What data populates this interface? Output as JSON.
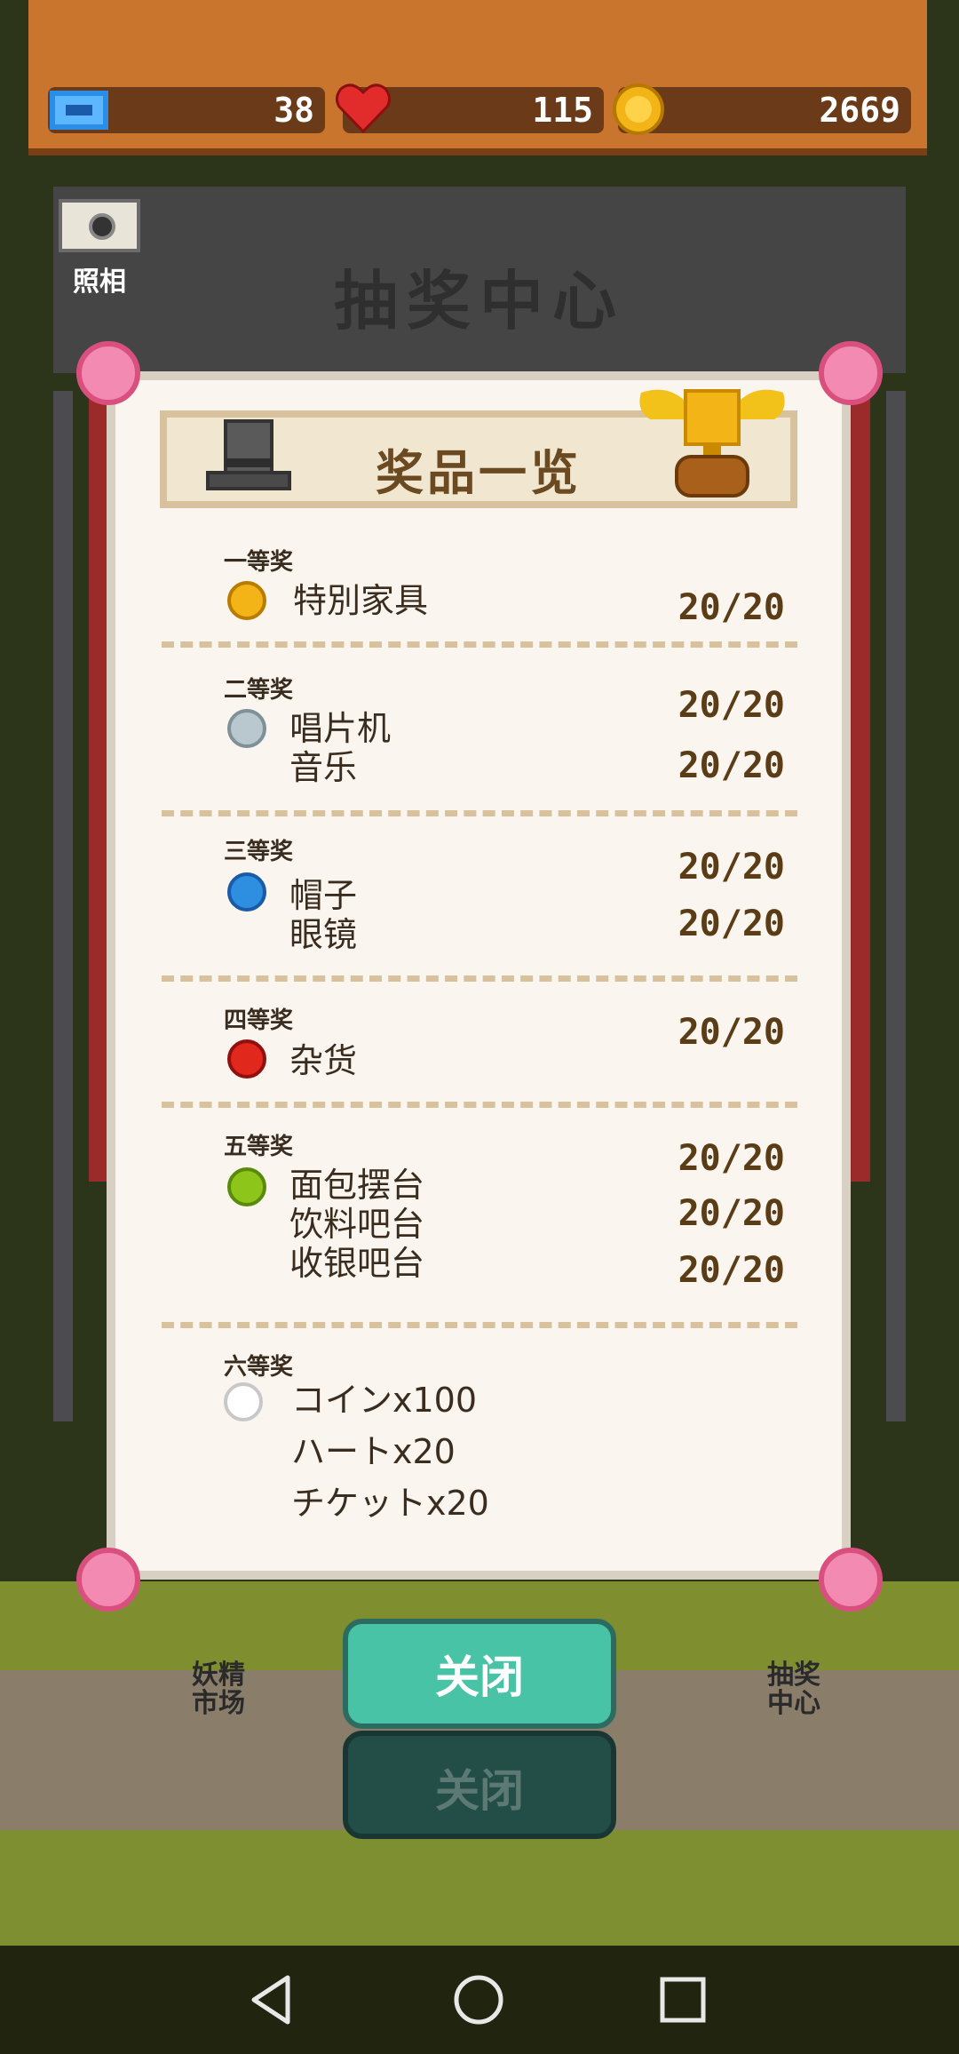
{
  "top_bar": {
    "tickets": "38",
    "hearts": "115",
    "coins": "2669",
    "ticket_icon": "ticket-icon",
    "heart_icon": "heart-icon",
    "coin_icon": "coin-icon"
  },
  "camera": {
    "label": "照相",
    "icon": "camera-icon"
  },
  "booth": {
    "title": "抽奖中心"
  },
  "dialog": {
    "title": "奖品一览",
    "tiers": [
      {
        "label": "一等奖",
        "orb_color": "#f2b416",
        "prizes": [
          {
            "name": "特別家具",
            "count": "20/20"
          }
        ]
      },
      {
        "label": "二等奖",
        "orb_color": "#b9c8cf",
        "prizes": [
          {
            "name": "唱片机",
            "count": "20/20"
          },
          {
            "name": "音乐",
            "count": "20/20"
          }
        ]
      },
      {
        "label": "三等奖",
        "orb_color": "#2e8fe0",
        "prizes": [
          {
            "name": "帽子",
            "count": "20/20"
          },
          {
            "name": "眼镜",
            "count": "20/20"
          }
        ]
      },
      {
        "label": "四等奖",
        "orb_color": "#e0281c",
        "prizes": [
          {
            "name": "杂货",
            "count": "20/20"
          }
        ]
      },
      {
        "label": "五等奖",
        "orb_color": "#8ec51a",
        "prizes": [
          {
            "name": "面包摆台",
            "count": "20/20"
          },
          {
            "name": "饮料吧台",
            "count": "20/20"
          },
          {
            "name": "收银吧台",
            "count": "20/20"
          }
        ]
      },
      {
        "label": "六等奖",
        "orb_color": "#ffffff",
        "prizes": [
          {
            "name": "コインx100"
          },
          {
            "name": "ハートx20"
          },
          {
            "name": "チケットx20"
          }
        ]
      }
    ]
  },
  "buttons": {
    "close": "关闭",
    "close_shadow": "关闭"
  },
  "scene_labels": {
    "fairy_market": "妖精\n市场",
    "lottery_center": "抽奖\n中心"
  },
  "nav": {
    "back_icon": "back-triangle-icon",
    "home_icon": "home-circle-icon",
    "recents_icon": "recents-square-icon"
  }
}
